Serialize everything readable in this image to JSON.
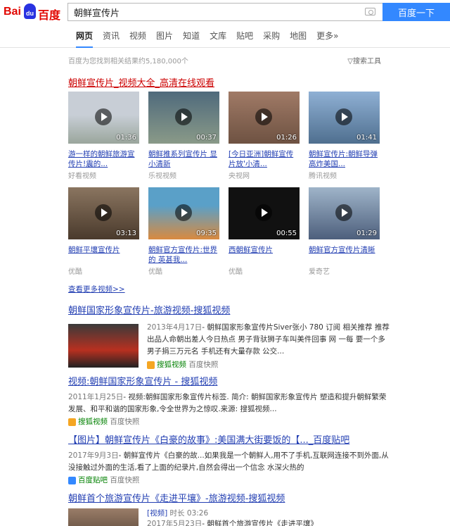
{
  "brand": {
    "logo_left": "Bai",
    "logo_right": "百度"
  },
  "search": {
    "query": "朝鲜宣传片",
    "button": "百度一下"
  },
  "nav": [
    "网页",
    "资讯",
    "视频",
    "图片",
    "知道",
    "文库",
    "贴吧",
    "采购",
    "地图",
    "更多»"
  ],
  "meta": {
    "count": "百度为您找到相关结果约5,180,000个",
    "tools": "搜索工具"
  },
  "video_block": {
    "title": "朝鲜宣传片_视频大全_高清在线观看",
    "more": "查看更多视频>>",
    "videos": [
      {
        "duration": "01:36",
        "title": "游一样的朝鲜旅游宣传片!震的...",
        "source": "好看视频",
        "color": "#9fa8a0"
      },
      {
        "duration": "00:37",
        "title": "朝鲜推系列宣传片 显小清新",
        "source": "乐视视频",
        "color": "#6a7f8a"
      },
      {
        "duration": "01:26",
        "title": "[今日亚洲]朝鲜宣传片放'小清...",
        "source": "央视网",
        "color": "#8a6a5a"
      },
      {
        "duration": "01:41",
        "title": "朝鲜宣传片:朝鲜导弹高炸美国...",
        "source": "腾讯视频",
        "color": "#6d8fb3"
      },
      {
        "duration": "03:13",
        "title": "朝鲜平壤宣传片",
        "source": "优酷",
        "color": "#7a6650"
      },
      {
        "duration": "09:35",
        "title": "朝鲜官方宣传片:世界的 英甚我...",
        "source": "优酷",
        "color": "#c0813f"
      },
      {
        "duration": "00:55",
        "title": "西朝鲜宣传片",
        "source": "优酷",
        "color": "#111111"
      },
      {
        "duration": "01:29",
        "title": "朝鲜官方宣传片清晰",
        "source": "爱奇艺",
        "color": "#5f7392"
      }
    ]
  },
  "results": [
    {
      "title": "朝鲜国家形象宣传片-旅游视频-搜狐视频",
      "date": "2013年4月17日",
      "abstract": "- 朝鲜国家形象宣传片Siver张小 780 订阅 相关推荐 推荐出品人命朝出差人今日热点 男子背驮狮子车叫美件回事 网 一每 要一个多 男子捐三万元名 手机还有大量存款 公交...",
      "source": "搜狐视频",
      "extra": "百度快照"
    },
    {
      "title": "视频:朝鲜国家形象宣传片 - 搜狐视频",
      "date": "2011年1月25日",
      "abstract": "- 视频:朝鲜国家形象宣传片标签. 简介: 朝鲜国家形象宣传片 塑造和提升朝鲜繁荣发展、和平和谐的国家形象,令全世界为之惊叹.来源: 搜狐视频...",
      "source": "搜狐视频",
      "extra": "百度快照"
    },
    {
      "title": "【图片】朝鲜宣传片《白豪的故事》:美国满大街要饭的【..._百度贴吧",
      "date": "2017年9月3日",
      "abstract": "- 朝鲜宣传片《白豪的故...如果我是一个朝鲜人,用不了手机,互联网连接不到外面,从没接触过外面的生活,看了上面的纪录片,自然会得出一个信念 水深火热的",
      "source": "百度贴吧",
      "extra": "百度快照"
    },
    {
      "title": "朝鲜首个旅游宣传片《走进平壤》-旅游视频-搜狐视频",
      "label": "[视频]",
      "length": "时长 03:26",
      "date": "2017年5月23日",
      "abstract": "- 朝鲜首个旅游宣传片《走进平壤》"
    }
  ]
}
